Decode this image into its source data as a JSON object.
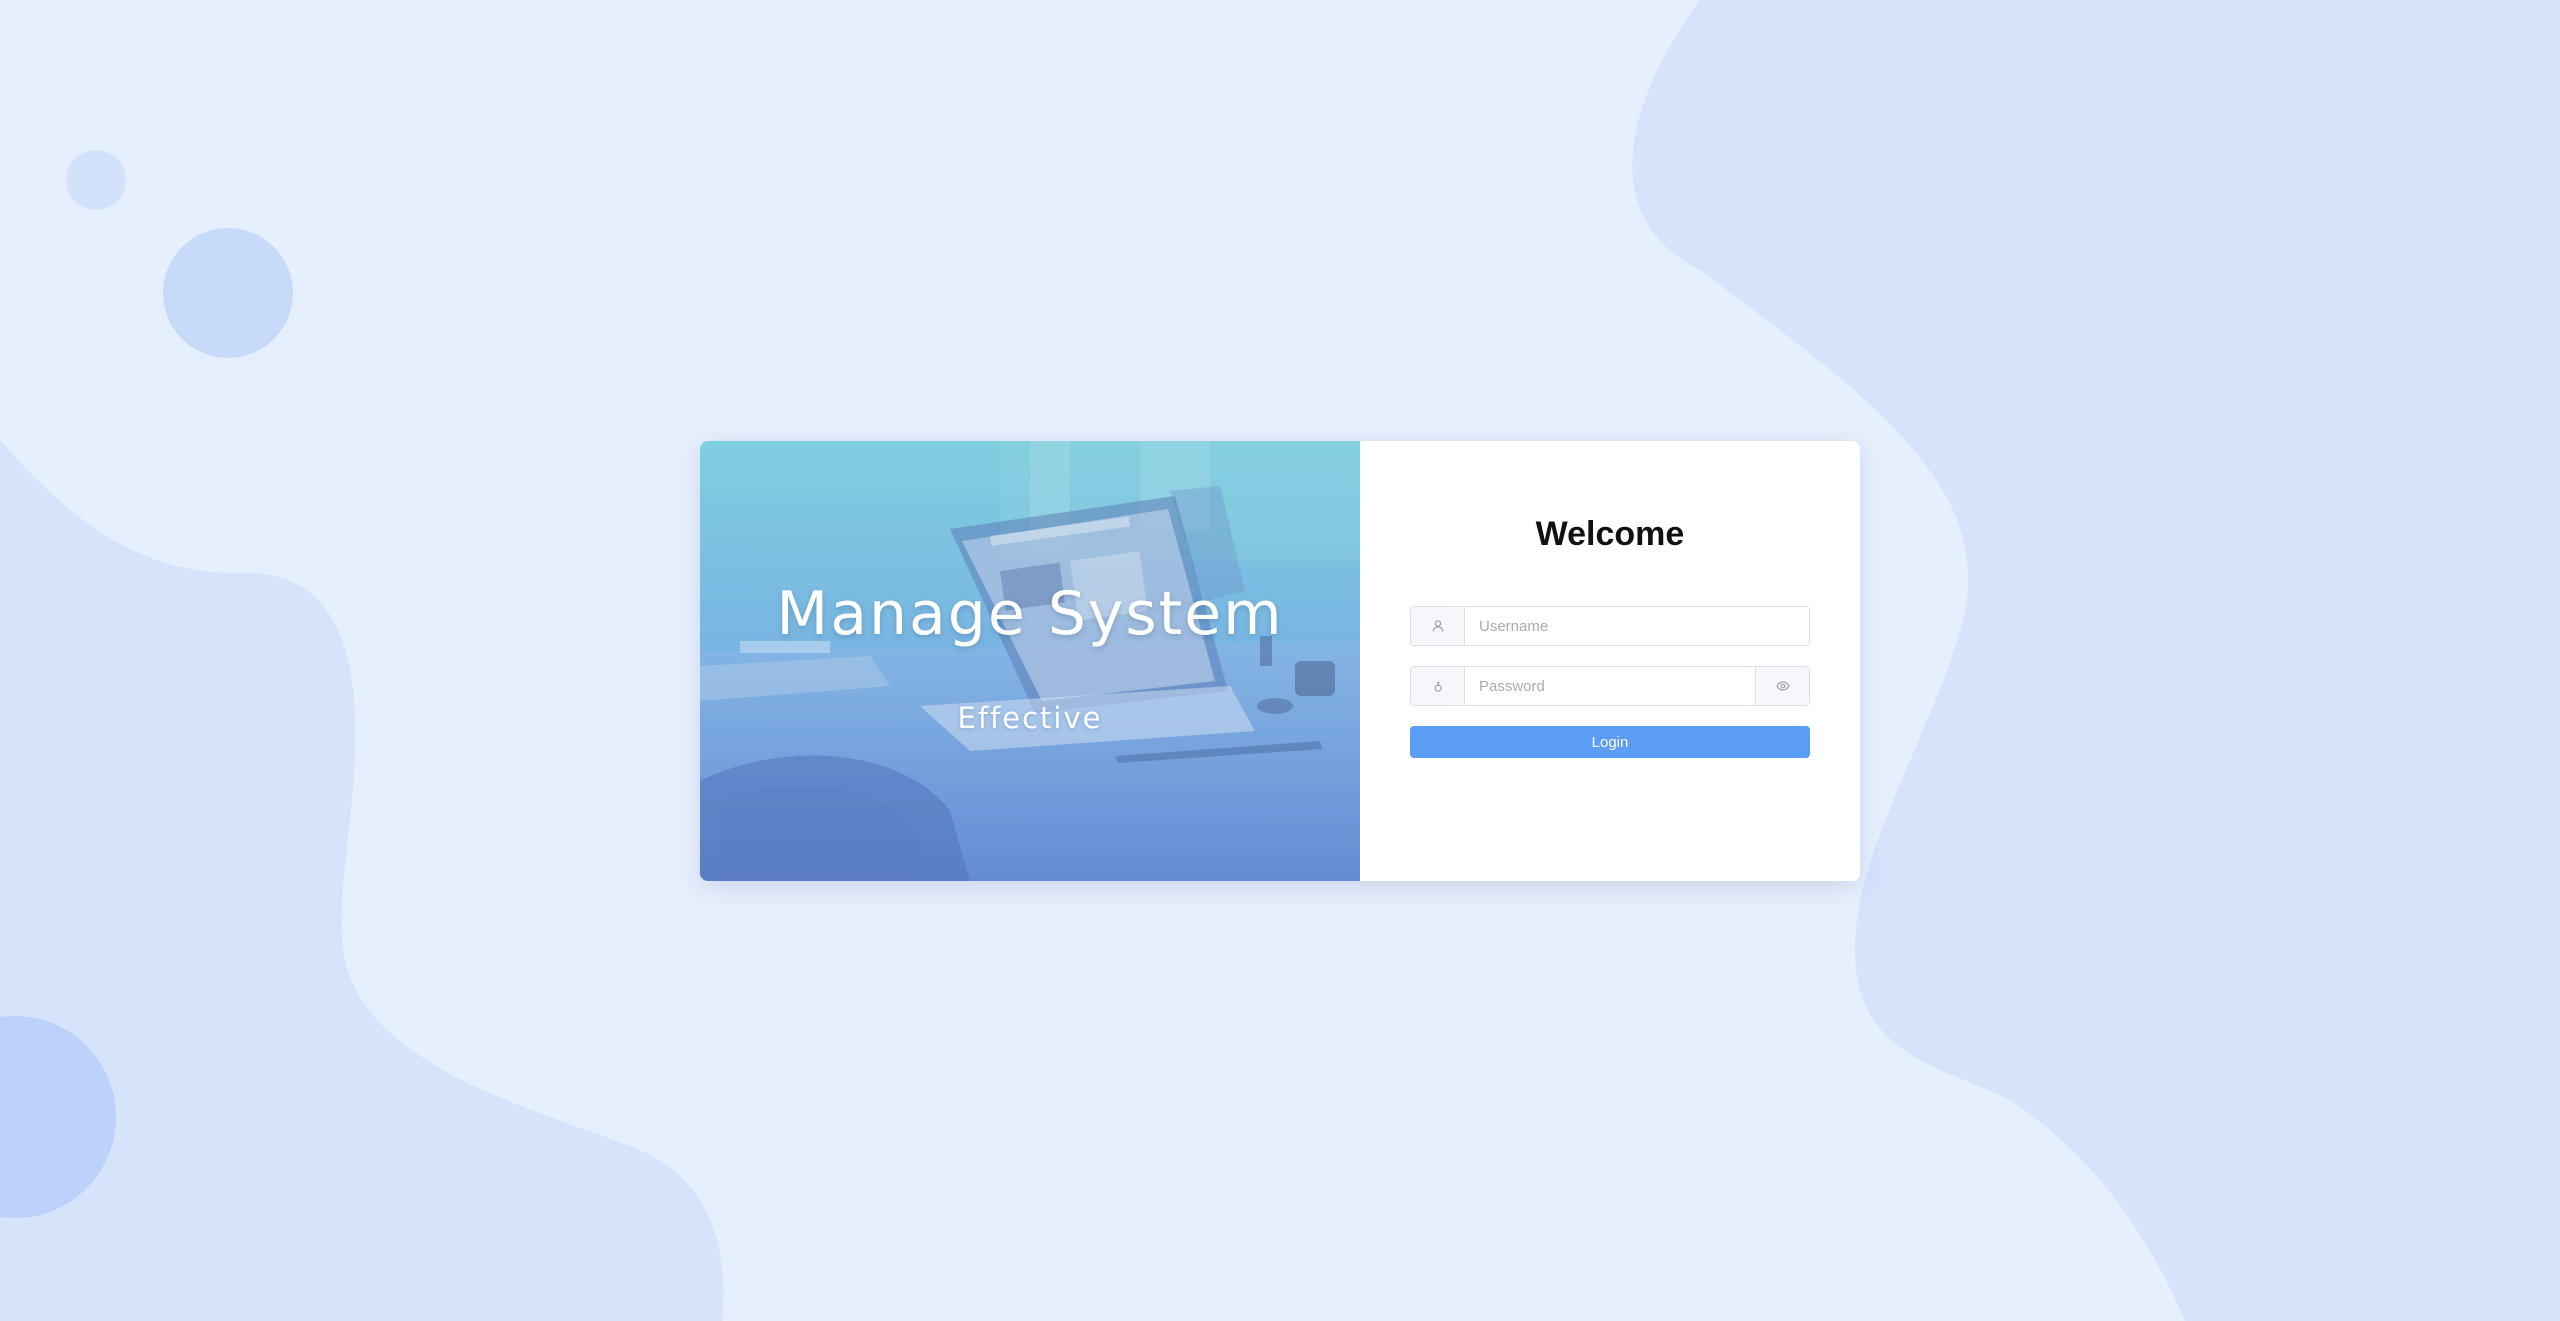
{
  "hero": {
    "title": "Manage System",
    "subtitle": "Effective"
  },
  "login": {
    "heading": "Welcome",
    "username_placeholder": "Username",
    "username_value": "",
    "password_placeholder": "Password",
    "password_value": "",
    "submit_label": "Login"
  },
  "icons": {
    "username_prefix": "user-icon",
    "password_prefix": "lock-icon",
    "password_toggle": "eye-icon"
  },
  "colors": {
    "page_background": "#e6effd",
    "blob": "#d5e3fb",
    "circle": "#c5d8fa",
    "primary_button": "#5b9cf4",
    "heading_text": "#111111"
  }
}
